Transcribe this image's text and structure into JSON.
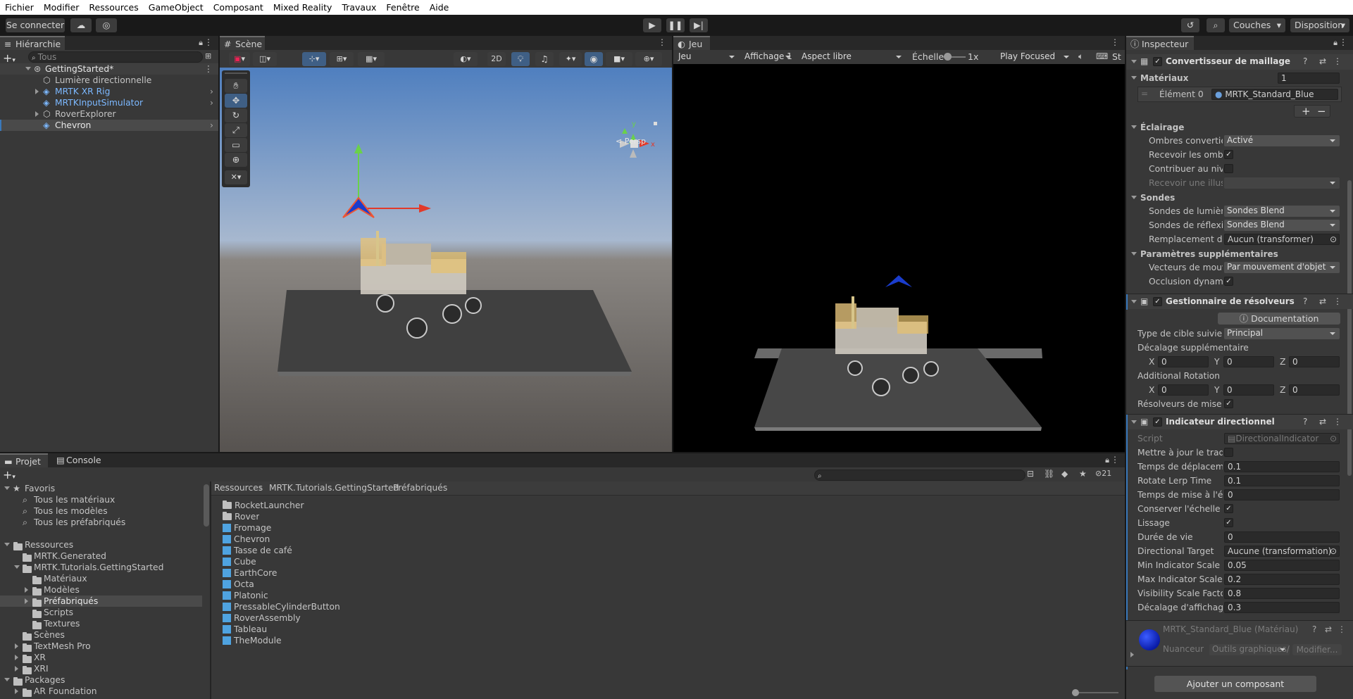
{
  "menu": [
    "Fichier",
    "Modifier",
    "Ressources",
    "GameObject",
    "Composant",
    "Mixed Reality",
    "Travaux",
    "Fenêtre",
    "Aide"
  ],
  "toolbar": {
    "connect": "Se connecter",
    "layers": "Couches",
    "layout": "Disposition"
  },
  "hierarchy": {
    "tab": "Hiérarchie",
    "search_placeholder": "Tous",
    "scene": "GettingStarted*",
    "items": [
      "Lumière directionnelle",
      "MRTK XR Rig",
      "MRTKInputSimulator",
      "RoverExplorer",
      "Chevron"
    ]
  },
  "scene": {
    "tab": "Scène",
    "mode2d": "2D",
    "persp": "< Persp"
  },
  "game": {
    "tab": "Jeu",
    "display_select": "Jeu",
    "display": "Affichage 1",
    "aspect": "Aspect libre",
    "scale_label": "Échelle",
    "scale_value": "1x",
    "play_mode": "Play Focused",
    "stats": "St"
  },
  "project": {
    "tab": "Projet",
    "console_tab": "Console",
    "hidden_count": "21",
    "favorites": {
      "label": "Favoris",
      "items": [
        "Tous les matériaux",
        "Tous les modèles",
        "Tous les préfabriqués"
      ]
    },
    "assets": {
      "label": "Ressources",
      "items": [
        "MRTK.Generated",
        "MRTK.Tutorials.GettingStarted",
        "Matériaux",
        "Modèles",
        "Préfabriqués",
        "Scripts",
        "Textures",
        "Scènes",
        "TextMesh Pro",
        "XR",
        "XRI"
      ]
    },
    "packages": {
      "label": "Packages",
      "items": [
        "AR Foundation"
      ]
    },
    "breadcrumb": [
      "Ressources",
      "MRTK.Tutorials.GettingStarted",
      "Préfabriqués"
    ],
    "files": [
      "RocketLauncher",
      "Rover",
      "Fromage",
      "Chevron",
      "Tasse de café",
      "Cube",
      "EarthCore",
      "Octa",
      "Platonic",
      "PressableCylinderButton",
      "RoverAssembly",
      "Tableau",
      "TheModule"
    ]
  },
  "inspector": {
    "tab": "Inspecteur",
    "mesh_renderer": {
      "title": "Convertisseur de maillage",
      "materials_label": "Matériaux",
      "materials_count": "1",
      "element_label": "Élément 0",
      "element_value": "MRTK_Standard_Blue"
    },
    "lighting": {
      "title": "Éclairage",
      "cast_shadows": "Ombres converties",
      "cast_shadows_value": "Activé",
      "receive_shadows": "Recevoir les ombres",
      "contribute_gi": "Contribuer au niveau",
      "receive_gi": "Recevoir une illustr"
    },
    "probes": {
      "title": "Sondes",
      "light_probes": "Sondes de lumière",
      "light_probes_value": "Sondes Blend",
      "reflection_probes": "Sondes de réflexion",
      "reflection_probes_value": "Sondes Blend",
      "anchor_override": "Remplacement d'an",
      "anchor_override_value": "Aucun (transformer)"
    },
    "additional": {
      "title": "Paramètres supplémentaires",
      "motion_vectors": "Vecteurs de mouver",
      "motion_vectors_value": "Par mouvement d'objet",
      "dynamic_occlusion": "Occlusion dynamiqu"
    },
    "solver_handler": {
      "title": "Gestionnaire de résolveurs",
      "documentation": "Documentation",
      "tracked_type": "Type de cible suivie",
      "tracked_type_value": "Principal",
      "offset_label": "Décalage supplémentaire",
      "rotation_label": "Additional Rotation",
      "x": "0",
      "y": "0",
      "z": "0",
      "update_solvers": "Résolveurs de mise à jo"
    },
    "directional": {
      "title": "Indicateur directionnel",
      "script_label": "Script",
      "script_value": "DirectionalIndicator",
      "fields": [
        {
          "label": "Mettre à jour le traduc",
          "value": ""
        },
        {
          "label": "Temps de déplacemen",
          "value": "0.1"
        },
        {
          "label": "Rotate Lerp Time",
          "value": "0.1"
        },
        {
          "label": "Temps de mise à l'éch",
          "value": "0"
        },
        {
          "label": "Conserver l'échelle lor",
          "value": ""
        },
        {
          "label": "Lissage",
          "value": ""
        },
        {
          "label": "Durée de vie",
          "value": "0"
        },
        {
          "label": "Directional Target",
          "value": "Aucune (transformation)"
        },
        {
          "label": "Min Indicator Scale",
          "value": "0.05"
        },
        {
          "label": "Max Indicator Scale",
          "value": "0.2"
        },
        {
          "label": "Visibility Scale Factor",
          "value": "0.8"
        },
        {
          "label": "Décalage d'affichage",
          "value": "0.3"
        }
      ]
    },
    "material": {
      "title": "MRTK_Standard_Blue (Matériau)",
      "shader_label": "Nuanceur",
      "shader_value": "Outils graphiques/",
      "edit": "Modifier..."
    },
    "add_component": "Ajouter un composant"
  },
  "colors": {
    "accent": "#2c5d87",
    "selection": "#2c5d87",
    "link_blue": "#7cb8ff",
    "x_axis": "#e23a2a",
    "y_axis": "#6ad14a",
    "chevron": "#1a3ccc"
  }
}
